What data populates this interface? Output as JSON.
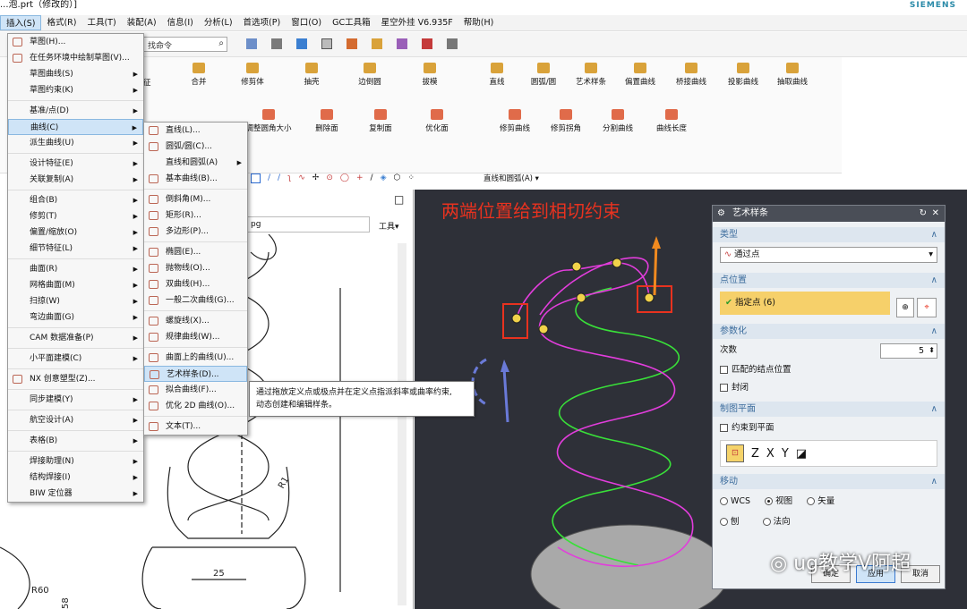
{
  "window": {
    "title": "...泡.prt（修改的）]",
    "brand": "SIEMENS"
  },
  "menubar": [
    "插入(S)",
    "格式(R)",
    "工具(T)",
    "装配(A)",
    "信息(I)",
    "分析(L)",
    "首选项(P)",
    "窗口(O)",
    "GC工具箱",
    "星空外挂 V6.935F",
    "帮助(H)"
  ],
  "search": {
    "placeholder": "找命令"
  },
  "ribbon": {
    "row1": [
      "合并",
      "修剪体",
      "抽壳",
      "边倒圆",
      "拔模",
      "直线",
      "圆弧/圆",
      "艺术样条",
      "偏置曲线",
      "桥接曲线",
      "投影曲线",
      "抽取曲线"
    ],
    "row1_left": "征",
    "row2": [
      "调整圆角大小",
      "删除面",
      "复制面",
      "优化面",
      "修剪曲线",
      "修剪拐角",
      "分割曲线",
      "曲线长度"
    ],
    "snap_dropdown": "直线和圆弧(A)"
  },
  "insert_menu": {
    "items": [
      {
        "label": "草图(H)...",
        "arrow": false,
        "icon": "sketch-icon"
      },
      {
        "label": "在任务环境中绘制草图(V)...",
        "arrow": false,
        "icon": "sketch-task-icon"
      },
      {
        "label": "草图曲线(S)",
        "arrow": true
      },
      {
        "label": "草图约束(K)",
        "arrow": true
      },
      {
        "sep": true
      },
      {
        "label": "基准/点(D)",
        "arrow": true
      },
      {
        "label": "曲线(C)",
        "arrow": true,
        "highlight": true
      },
      {
        "label": "派生曲线(U)",
        "arrow": true
      },
      {
        "sep": true
      },
      {
        "label": "设计特征(E)",
        "arrow": true
      },
      {
        "label": "关联复制(A)",
        "arrow": true
      },
      {
        "sep": true
      },
      {
        "label": "组合(B)",
        "arrow": true
      },
      {
        "label": "修剪(T)",
        "arrow": true
      },
      {
        "label": "偏置/缩放(O)",
        "arrow": true
      },
      {
        "label": "细节特征(L)",
        "arrow": true
      },
      {
        "sep": true
      },
      {
        "label": "曲面(R)",
        "arrow": true
      },
      {
        "label": "网格曲面(M)",
        "arrow": true
      },
      {
        "label": "扫掠(W)",
        "arrow": true
      },
      {
        "label": "弯边曲面(G)",
        "arrow": true
      },
      {
        "sep": true
      },
      {
        "label": "CAM 数据准备(P)",
        "arrow": true
      },
      {
        "sep": true
      },
      {
        "label": "小平面建模(C)",
        "arrow": true
      },
      {
        "sep": true
      },
      {
        "label": "NX 创意塑型(Z)...",
        "arrow": false,
        "icon": "nx-creative-icon"
      },
      {
        "sep": true
      },
      {
        "label": "同步建模(Y)",
        "arrow": true
      },
      {
        "sep": true
      },
      {
        "label": "航空设计(A)",
        "arrow": true
      },
      {
        "sep": true
      },
      {
        "label": "表格(B)",
        "arrow": true
      },
      {
        "sep": true
      },
      {
        "label": "焊接助理(N)",
        "arrow": true
      },
      {
        "label": "结构焊接(I)",
        "arrow": true
      },
      {
        "label": "BIW 定位器",
        "arrow": true
      }
    ]
  },
  "curve_menu": {
    "items": [
      {
        "label": "直线(L)...",
        "icon": "line-icon"
      },
      {
        "label": "圆弧/圆(C)...",
        "icon": "arc-icon"
      },
      {
        "label": "直线和圆弧(A)",
        "arrow": true
      },
      {
        "label": "基本曲线(B)...",
        "icon": "basic-curve-icon"
      },
      {
        "sep": true
      },
      {
        "label": "倒斜角(M)...",
        "icon": "chamfer-icon"
      },
      {
        "label": "矩形(R)...",
        "icon": "rectangle-icon"
      },
      {
        "label": "多边形(P)...",
        "icon": "polygon-icon"
      },
      {
        "sep": true
      },
      {
        "label": "椭圆(E)...",
        "icon": "ellipse-icon"
      },
      {
        "label": "抛物线(O)...",
        "icon": "parabola-icon"
      },
      {
        "label": "双曲线(H)...",
        "icon": "hyperbola-icon"
      },
      {
        "label": "一般二次曲线(G)...",
        "icon": "conic-icon"
      },
      {
        "sep": true
      },
      {
        "label": "螺旋线(X)...",
        "icon": "helix-icon"
      },
      {
        "label": "规律曲线(W)...",
        "icon": "law-curve-icon"
      },
      {
        "sep": true
      },
      {
        "label": "曲面上的曲线(U)...",
        "icon": "curve-on-surface-icon"
      },
      {
        "label": "艺术样条(D)...",
        "icon": "studio-spline-icon",
        "highlight": true
      },
      {
        "label": "拟合曲线(F)...",
        "icon": "fit-curve-icon"
      },
      {
        "label": "优化 2D 曲线(O)...",
        "icon": "optimize-2d-icon"
      },
      {
        "sep": true
      },
      {
        "label": "文本(T)...",
        "icon": "text-icon"
      }
    ]
  },
  "tooltip": {
    "line1": "通过拖放定义点或极点并在定义点指派斜率或曲率约束,",
    "line2": "动态创建和编辑样条。"
  },
  "drawing": {
    "dim_25": "25",
    "dim_r60": "R60",
    "dim_r1": "R1",
    "dim_58": "58",
    "tools_label": "工具▾",
    "path_suffix": "pg"
  },
  "annotation": "两端位置给到相切约束",
  "dialog": {
    "title": "艺术样条",
    "type_section": "类型",
    "type_value": "通过点",
    "points_section": "点位置",
    "specify_point": "指定点 (6)",
    "param_section": "参数化",
    "degree_label": "次数",
    "degree_value": "5",
    "match_knots": "匹配的结点位置",
    "closed": "封闭",
    "plane_section": "制图平面",
    "constrain_plane": "约束到平面",
    "move_section": "移动",
    "radio_wcs": "WCS",
    "radio_view": "视图",
    "radio_vector": "矢量",
    "radio_plane": "刨",
    "radio_normal": "法向",
    "ok": "确定",
    "apply": "应用",
    "cancel": "取消"
  },
  "watermark": "ug教学V阿超"
}
